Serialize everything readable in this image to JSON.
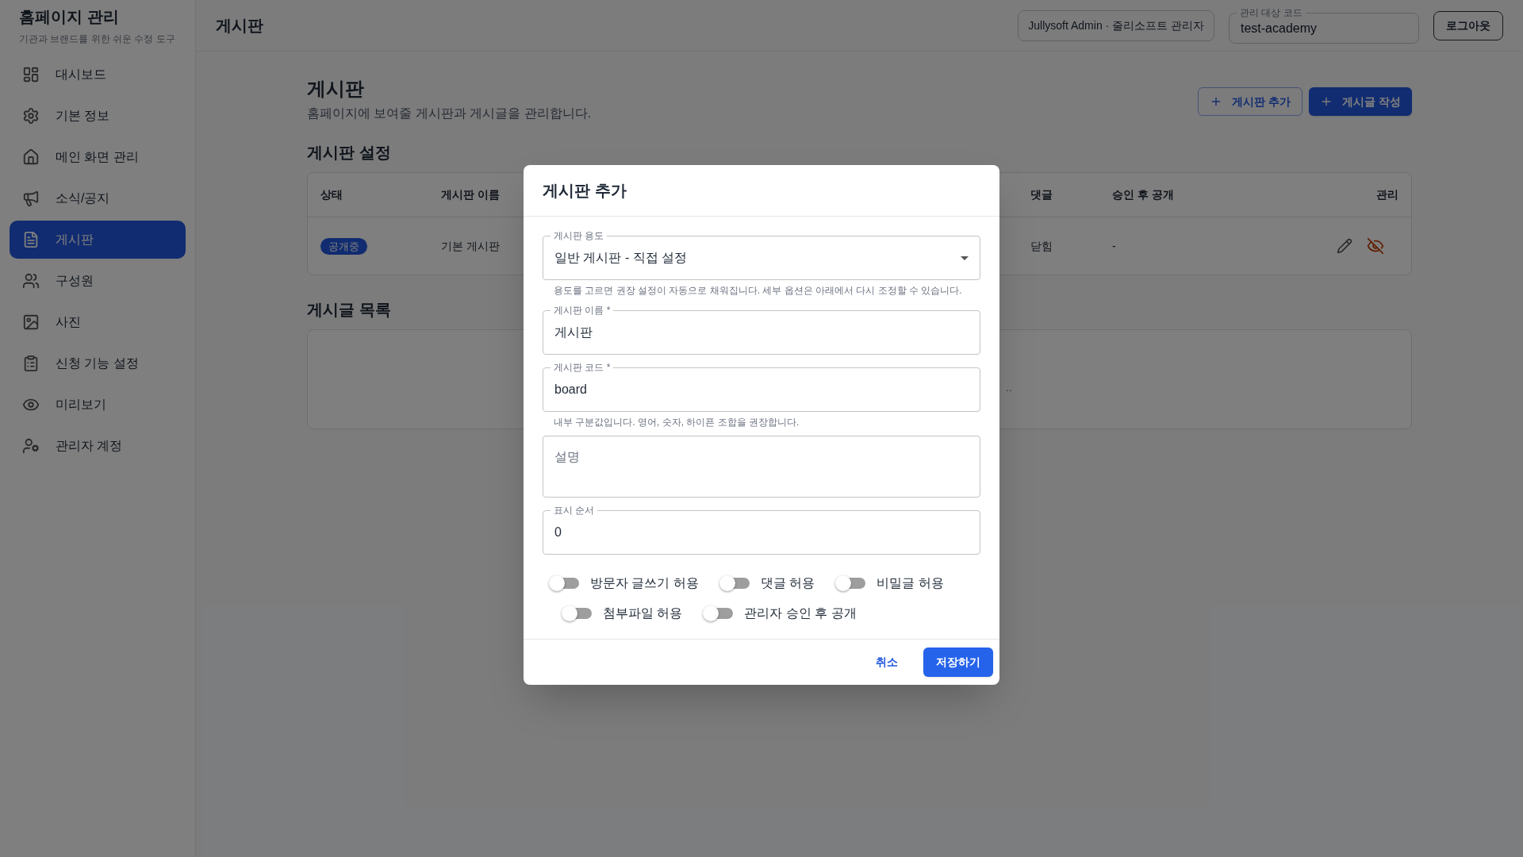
{
  "sidebar": {
    "title": "홈페이지 관리",
    "subtitle": "기관과 브랜드를 위한 쉬운 수정 도구",
    "items": [
      {
        "label": "대시보드",
        "selected": false
      },
      {
        "label": "기본 정보",
        "selected": false
      },
      {
        "label": "메인 화면 관리",
        "selected": false
      },
      {
        "label": "소식/공지",
        "selected": false
      },
      {
        "label": "게시판",
        "selected": true
      },
      {
        "label": "구성원",
        "selected": false
      },
      {
        "label": "사진",
        "selected": false
      },
      {
        "label": "신청 기능 설정",
        "selected": false
      },
      {
        "label": "미리보기",
        "selected": false
      },
      {
        "label": "관리자 계정",
        "selected": false
      }
    ]
  },
  "topbar": {
    "title": "게시판",
    "user_chip": "Jullysoft Admin · 줄리소프트 관리자",
    "code_field": {
      "label": "관리 대상 코드",
      "value": "test-academy"
    },
    "logout": "로그아웃"
  },
  "page": {
    "title": "게시판",
    "description": "홈페이지에 보여줄 게시판과 게시글을 관리합니다.",
    "actions": [
      {
        "label": "게시판 추가",
        "kind": "outline"
      },
      {
        "label": "게시글 작성",
        "kind": "solid"
      }
    ],
    "settings_title": "게시판 설정",
    "table": {
      "columns": [
        "상태",
        "게시판 이름",
        "댓글",
        "승인 후 공개",
        "관리"
      ],
      "rows": [
        {
          "status": "공개중",
          "name": "기본 게시판",
          "comments": "닫힘",
          "approval": "-"
        }
      ]
    },
    "posts_title": "게시글 목록",
    "posts_text": ".."
  },
  "modal": {
    "title": "게시판 추가",
    "fields": [
      {
        "kind": "select",
        "label": "게시판 용도",
        "value": "일반 게시판 - 직접 설정",
        "helper": "용도를 고르면 권장 설정이 자동으로 채워집니다. 세부 옵션은 아래에서 다시 조정할 수 있습니다."
      },
      {
        "kind": "text",
        "label": "게시판 이름 *",
        "value": "게시판"
      },
      {
        "kind": "text",
        "label": "게시판 코드 *",
        "value": "board",
        "helper": "내부 구분값입니다. 영어, 숫자, 하이픈 조합을 권장합니다."
      },
      {
        "kind": "textarea",
        "placeholder": "설명"
      },
      {
        "kind": "text",
        "label": "표시 순서",
        "value": "0"
      }
    ],
    "toggle_rows": [
      [
        {
          "label": "방문자 글쓰기 허용",
          "on": false
        },
        {
          "label": "댓글 허용",
          "on": false
        },
        {
          "label": "비밀글 허용",
          "on": false
        }
      ],
      [
        {
          "label": "첨부파일 허용",
          "on": false
        },
        {
          "label": "관리자 승인 후 공개",
          "on": false
        }
      ]
    ],
    "cancel": "취소",
    "save": "저장하기"
  }
}
